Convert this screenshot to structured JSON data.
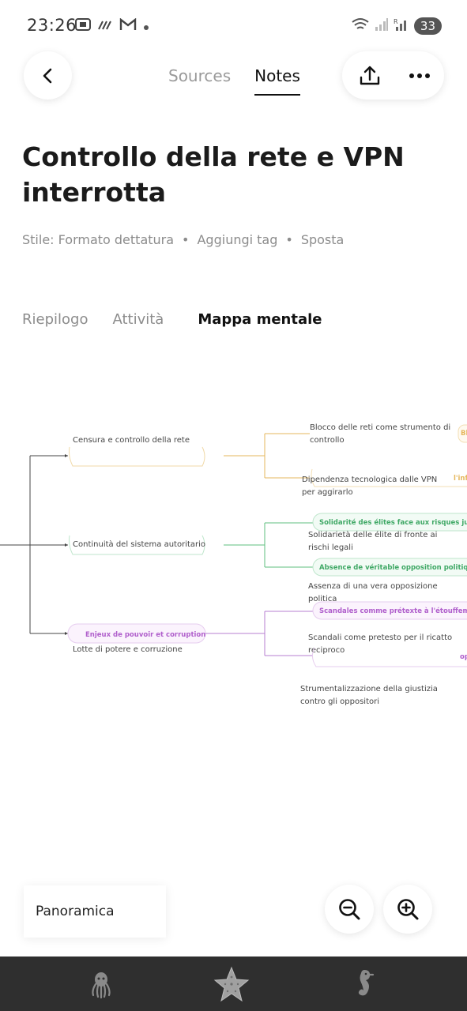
{
  "status_bar": {
    "time": "23:26",
    "battery": "33",
    "icons": [
      "screenshot-icon",
      "stripes-icon",
      "gmail-icon",
      "dot-icon",
      "wifi-icon",
      "signal-icon",
      "signal-r-icon"
    ]
  },
  "header": {
    "tabs": [
      {
        "label": "Sources",
        "active": false
      },
      {
        "label": "Notes",
        "active": true
      }
    ]
  },
  "note": {
    "title": "Controllo della rete e VPN interrotta",
    "meta": {
      "style": "Stile: Formato dettatura",
      "add_tag": "Aggiungi tag",
      "move": "Sposta",
      "separator": "•"
    }
  },
  "section_tabs": [
    {
      "label": "Riepilogo",
      "active": false
    },
    {
      "label": "Attività",
      "active": false
    },
    {
      "label": "Mappa mentale",
      "active": true
    }
  ],
  "mindmap": {
    "branches": [
      {
        "label": "Censura e controllo della rete",
        "color": "#e5b75c",
        "children": [
          {
            "label_line1": "Blocco delle reti come strumento di",
            "label_line2": "controllo",
            "tag": "Bl"
          },
          {
            "label_line1": "Dipendenza tecnologica dalle VPN",
            "label_line2": "per aggirarlo",
            "tag": "l'inf"
          }
        ]
      },
      {
        "label": "Continuità del sistema autoritario",
        "color": "#5fbf7f",
        "children": [
          {
            "tag": "Solidarité des élites face aux risques judiciair",
            "label_line1": "Solidarietà delle élite di fronte ai",
            "label_line2": "rischi legali"
          },
          {
            "tag": "Absence de véritable opposition politique via",
            "label_line1": "Assenza di una vera opposizione",
            "label_line2": "politica"
          }
        ]
      },
      {
        "label": "Lotte di potere e corruzione",
        "pill": "Enjeux de pouvoir et corruption",
        "color": "#b77fd0",
        "children": [
          {
            "tag": "Scandales comme prétexte à l'étouffement m",
            "label_line1": "Scandali come pretesto per il ricatto",
            "label_line2": "reciproco"
          },
          {
            "tag": "op",
            "label_line1": "Strumentalizzazione della giustizia",
            "label_line2": "contro gli oppositori"
          }
        ]
      }
    ]
  },
  "controls": {
    "overview": "Panoramica",
    "zoom_out_icon": "zoom-out-icon",
    "zoom_in_icon": "zoom-in-icon"
  },
  "navbar": {
    "icons": [
      "octopus-icon",
      "starfish-icon",
      "seahorse-icon"
    ]
  }
}
